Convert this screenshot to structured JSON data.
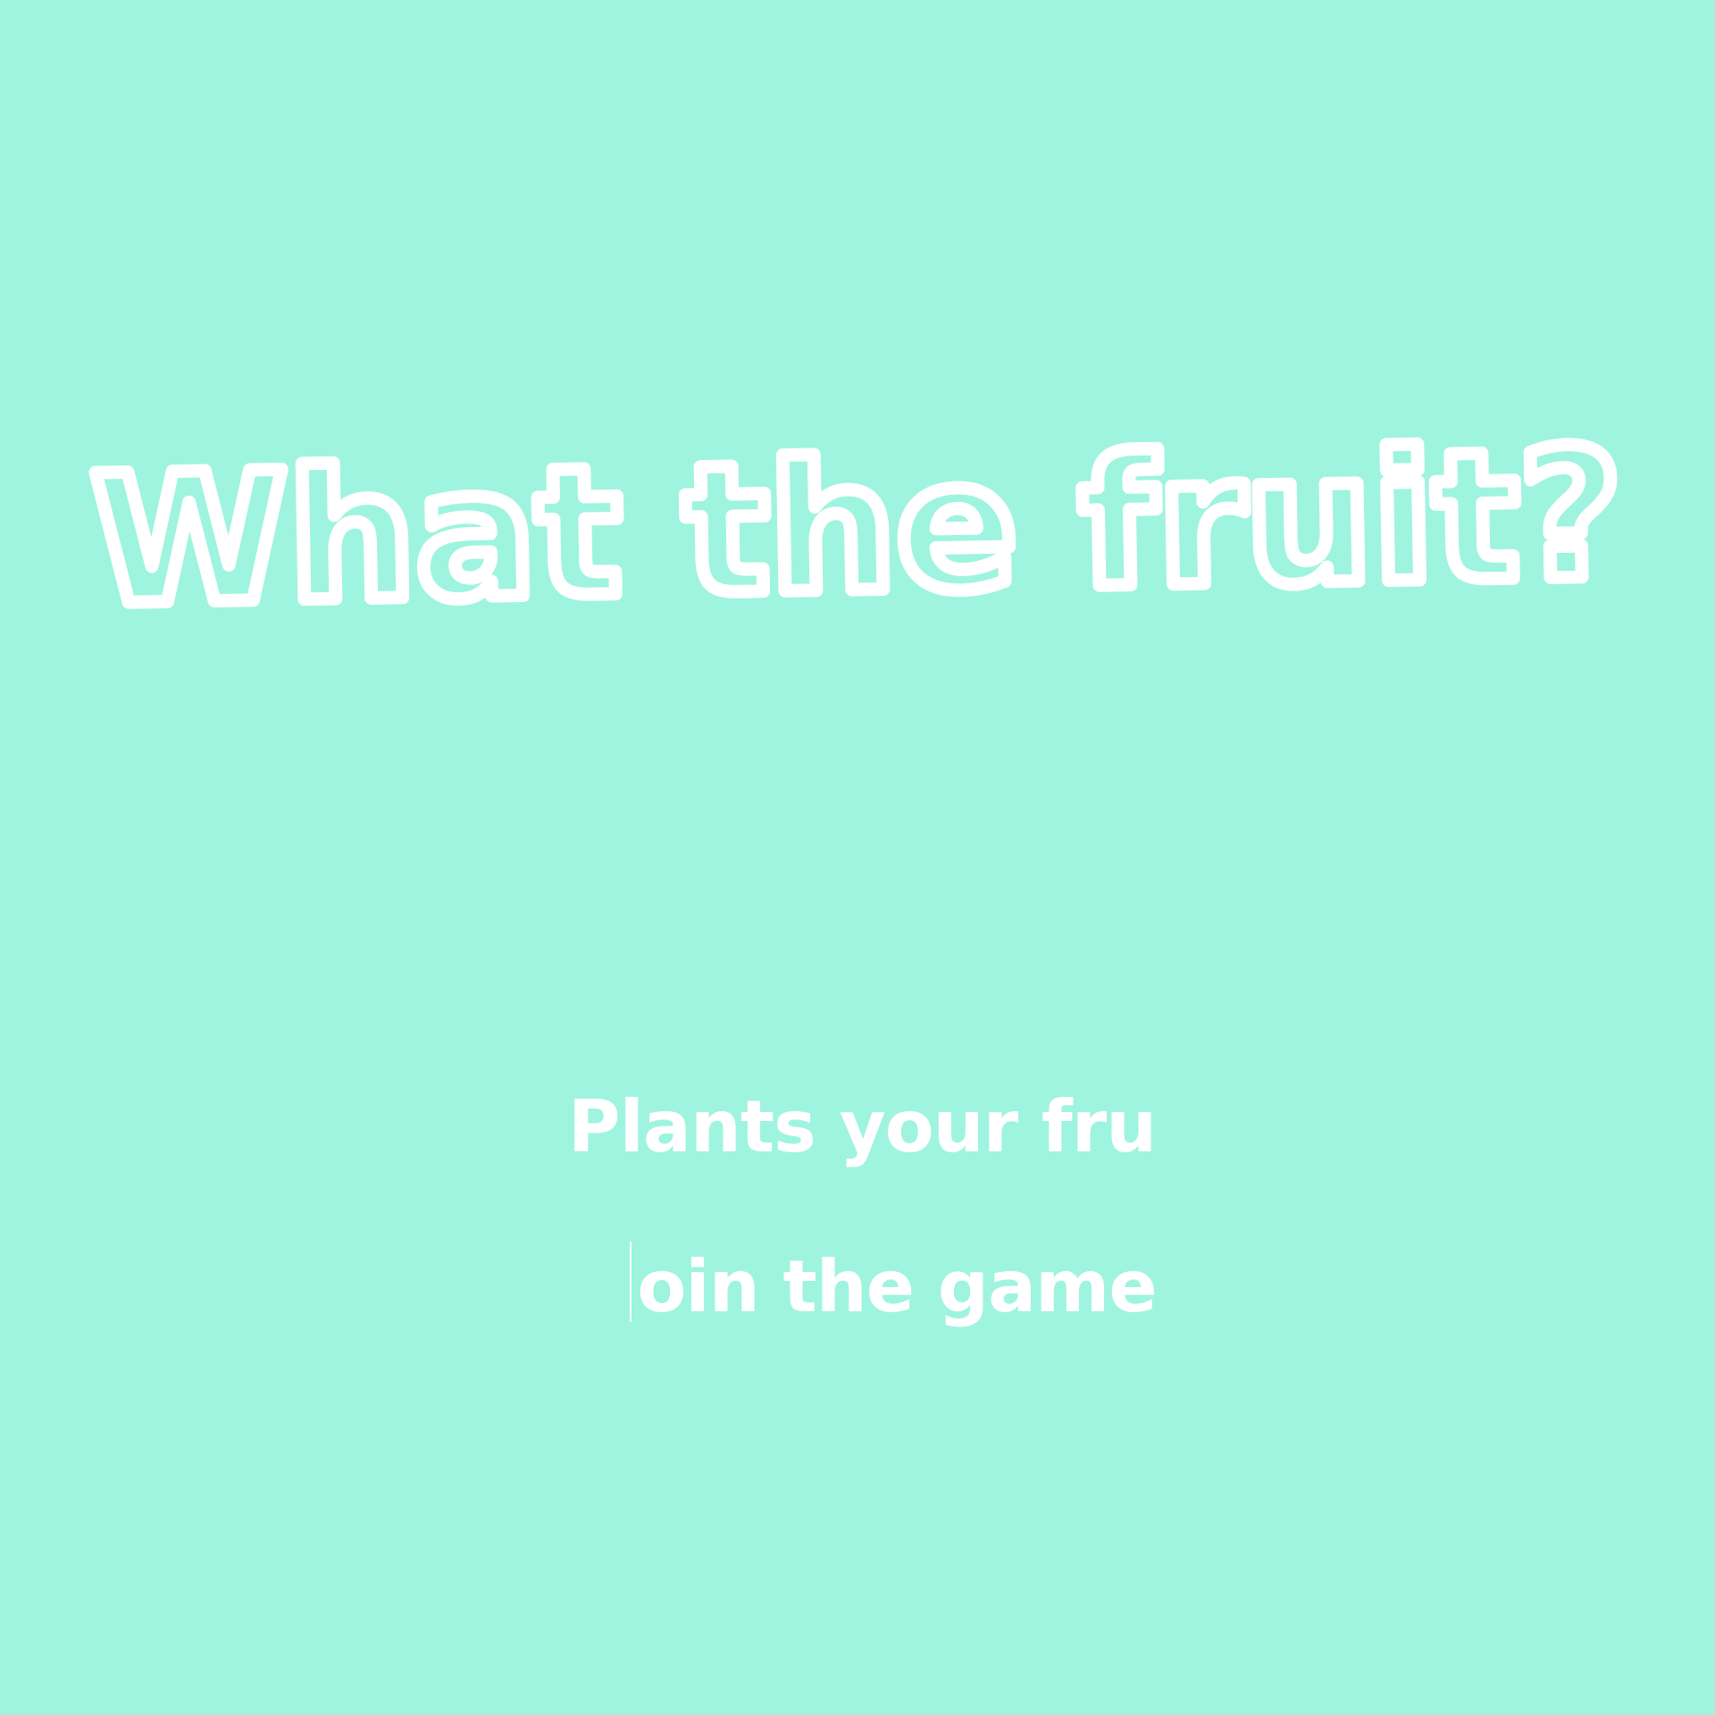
{
  "screen": {
    "background_color": "#9EF4DF",
    "text_color": "#FFFFFF"
  },
  "logo": {
    "title": "What the fruit?",
    "style": "outlined-bubble"
  },
  "tagline": {
    "line1": "Plants your fru",
    "line2": "oin the game",
    "cursor": "text-caret"
  }
}
